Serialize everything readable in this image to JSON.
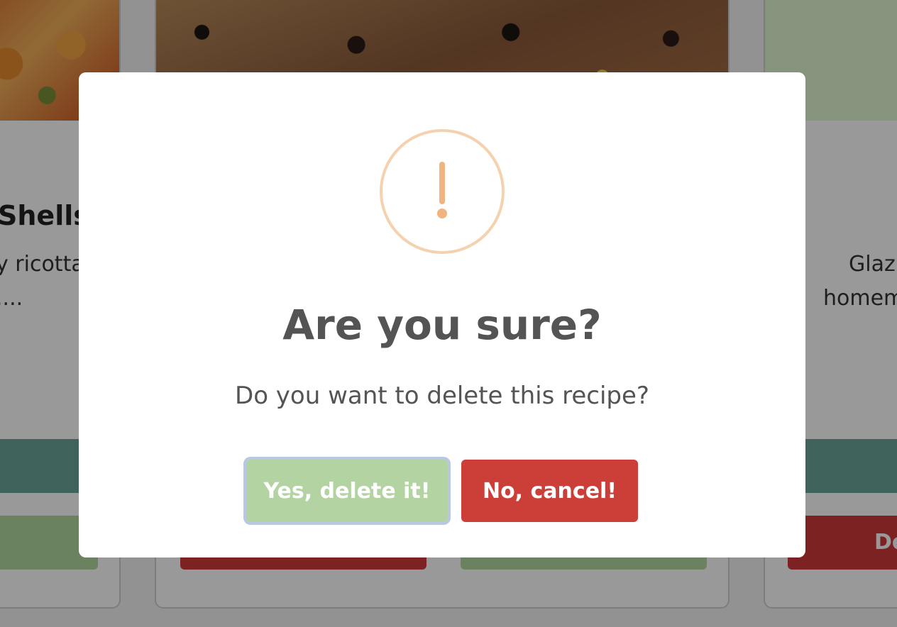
{
  "background_cards": [
    {
      "title": "Shells",
      "description_line1": "y ricotta",
      "description_line2": "...."
    },
    {
      "description_line1": "Glaz",
      "description_line2": "homem",
      "button_label": "De"
    }
  ],
  "dialog": {
    "icon": "warning-exclamation-icon",
    "icon_color": "#f0b47e",
    "title": "Are you sure?",
    "text": "Do you want to delete this recipe?",
    "confirm_label": "Yes, delete it!",
    "cancel_label": "No, cancel!",
    "confirm_color": "#b3d4a2",
    "cancel_color": "#cc3e38"
  }
}
